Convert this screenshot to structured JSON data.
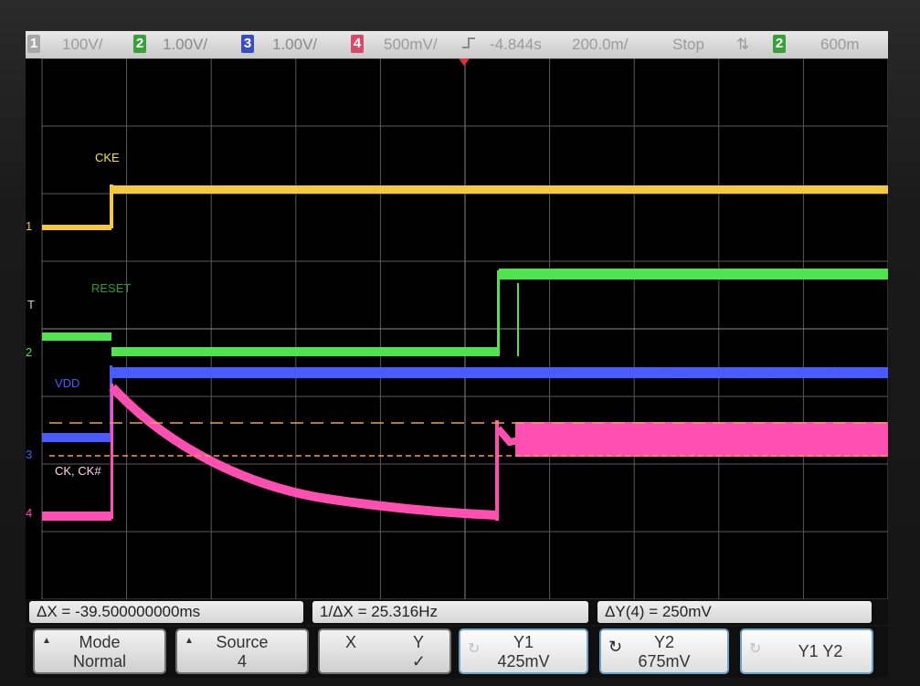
{
  "topbar": {
    "ch1_num": "1",
    "ch1_scale": "100V/",
    "ch2_num": "2",
    "ch2_scale": "1.00V/",
    "ch3_num": "3",
    "ch3_scale": "1.00V/",
    "ch4_num": "4",
    "ch4_scale": "500mV/",
    "delay": "-4.844s",
    "timebase": "200.0m/",
    "run_state": "Stop",
    "trigger_icon": "trigger-edge-icon",
    "trig_source": "2",
    "trig_level": "600m"
  },
  "traces": {
    "cke": "CKE",
    "reset": "RESET",
    "vdd": "VDD",
    "ck": "CK, CK#"
  },
  "markers": {
    "m1": "1",
    "m2": "2",
    "m3": "3",
    "m4": "4",
    "trig": "T"
  },
  "colors": {
    "ch1": "#f5c842",
    "ch2": "#4fe34f",
    "ch3": "#4a5cff",
    "ch4": "#ff4fb0",
    "cursor": "#f0a050"
  },
  "readout": {
    "dx": "ΔX = -39.500000000ms",
    "inv_dx": "1/ΔX = 25.316Hz",
    "dy": "ΔY(4) = 250mV"
  },
  "softkeys": {
    "mode_label": "Mode",
    "mode_value": "Normal",
    "source_label": "Source",
    "source_value": "4",
    "x_label": "X",
    "y_label": "Y",
    "y_check": "✓",
    "y1_label": "Y1",
    "y1_value": "425mV",
    "y2_label": "Y2",
    "y2_value": "675mV",
    "y1y2_label": "Y1 Y2"
  }
}
